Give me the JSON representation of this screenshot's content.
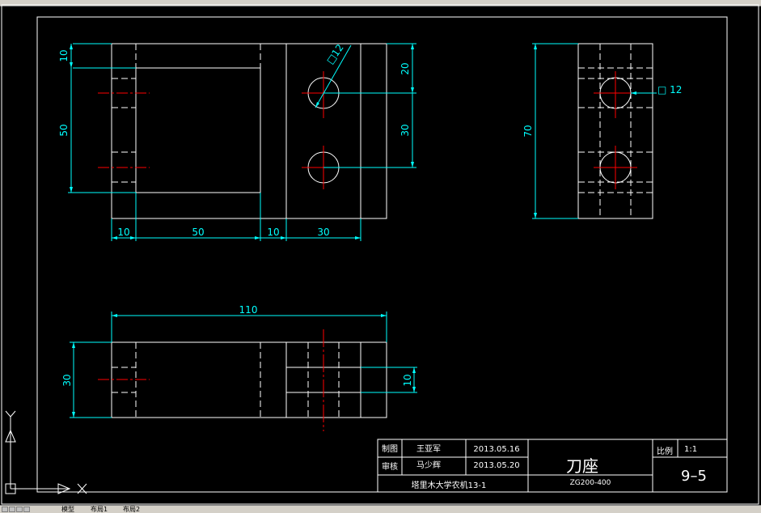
{
  "colors": {
    "background": "#000000",
    "geometry": "#ffffff",
    "dimension": "#00ffff",
    "centerline": "#ff0000",
    "titleblock_text": "#ffffff",
    "ui_chrome": "#d4d0c8"
  },
  "drawing": {
    "front_view": {
      "dims": {
        "top_10": "10",
        "left_50": "50",
        "right_20": "20",
        "right_30": "30",
        "bottom_10a": "10",
        "bottom_50": "50",
        "bottom_10b": "10",
        "bottom_30": "30",
        "hole": "□12"
      }
    },
    "side_view": {
      "dims": {
        "height_70": "70",
        "hole": "□ 12"
      }
    },
    "top_view": {
      "dims": {
        "width_110": "110",
        "height_30": "30",
        "slot_10": "10"
      }
    }
  },
  "title_block": {
    "drawn_label": "制图",
    "drawn_name": "王亚军",
    "drawn_date": "2013.05.16",
    "checked_label": "审核",
    "checked_name": "马少辉",
    "checked_date": "2013.05.20",
    "school": "塔里木大学农机13-1",
    "part_name": "刀座",
    "part_code": "ZG200-400",
    "scale_label": "比例",
    "scale_value": "1:1",
    "sheet_no": "9–5"
  },
  "ucs": {
    "y": "Y",
    "x": "X"
  },
  "tabs": [
    "模型",
    "布局1",
    "布局2"
  ]
}
